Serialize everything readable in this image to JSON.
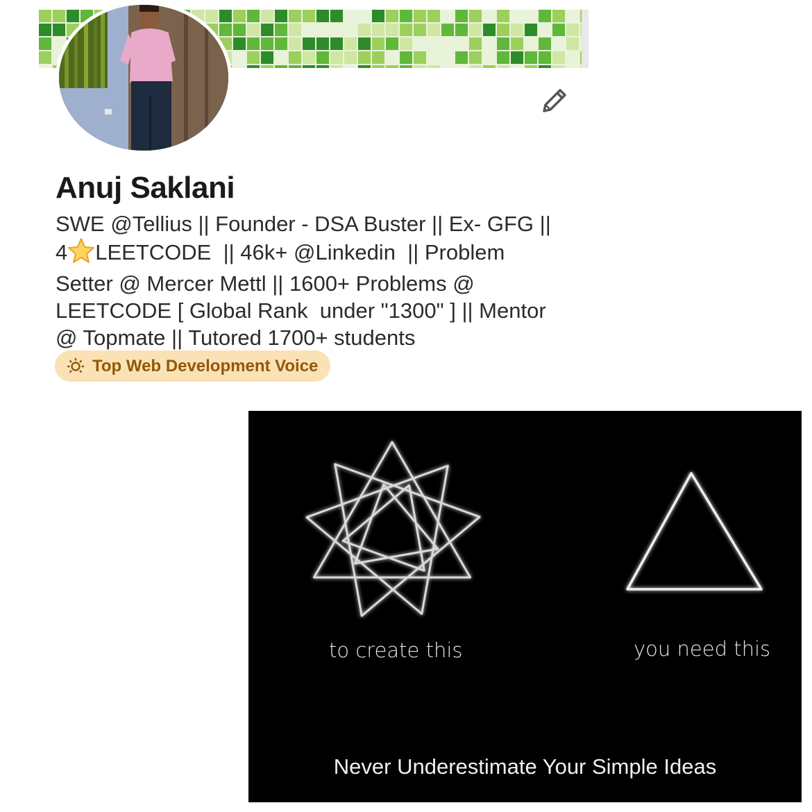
{
  "profile": {
    "name": "Anuj Saklani",
    "headline_lines": [
      "SWE @Tellius || Founder - DSA Buster || Ex- GFG ||",
      "LEETCODE  || 46k+ @Linkedin  || Problem",
      "Setter @ Mercer Mettl || 1600+ Problems @",
      "LEETCODE [ Global Rank  under \"1300\" ] || Mentor",
      "@ Topmate || Tutored 1700+ students"
    ],
    "headline_star_prefix": "4",
    "badge": {
      "icon": "lightbulb-icon",
      "label": "Top Web Development Voice"
    },
    "edit_icon": "pencil-icon"
  },
  "post_image": {
    "caption_left": "to create this",
    "caption_right": "you need this",
    "caption_bottom": "Never Underestimate Your Simple Ideas"
  },
  "colors": {
    "badge_bg": "#fbe1b6",
    "badge_text": "#915907",
    "banner_greens": [
      "#2e8b2a",
      "#5fb83a",
      "#9ccf5c",
      "#cfe7a2",
      "#e9f3da"
    ],
    "post_bg": "#000000"
  }
}
